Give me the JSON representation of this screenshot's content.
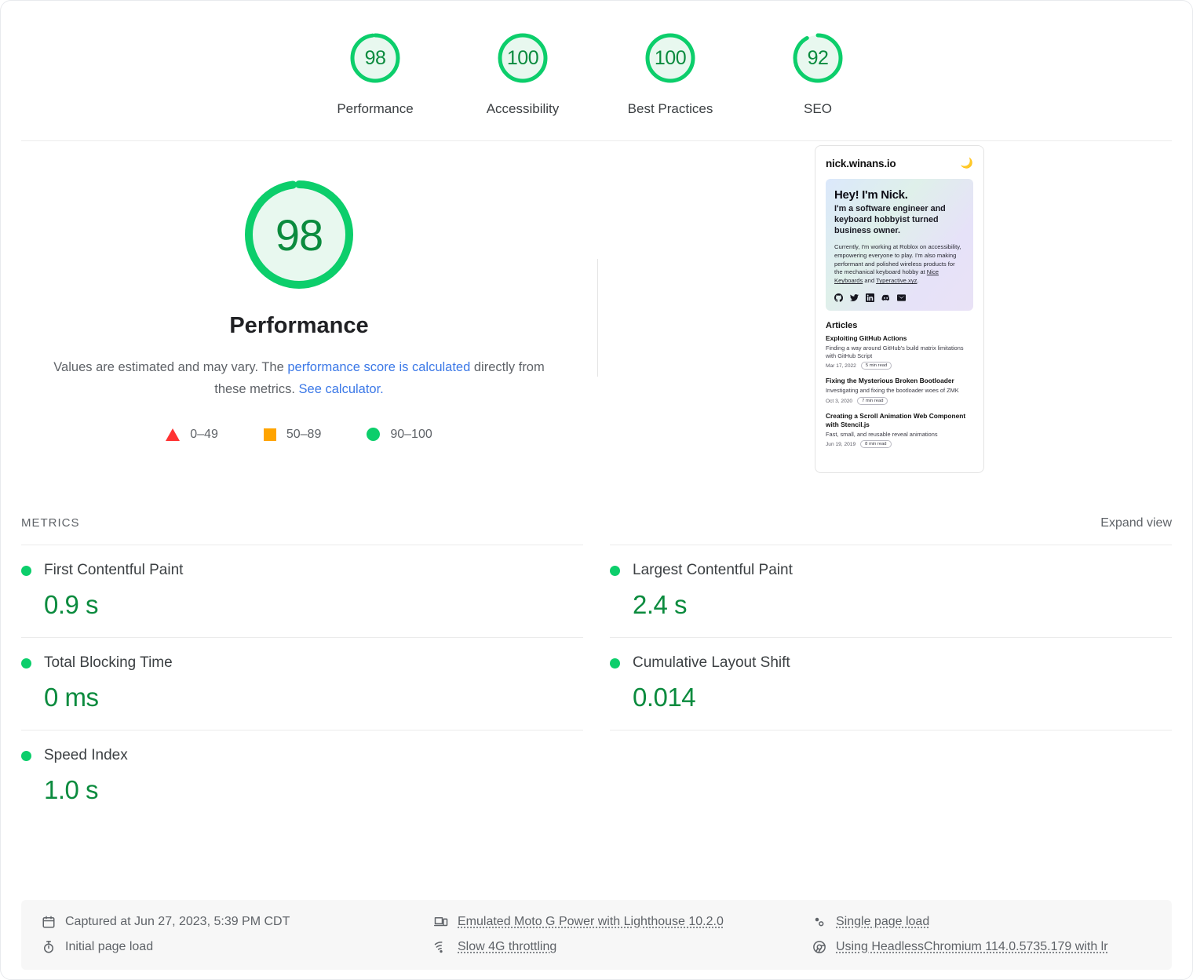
{
  "scores": [
    {
      "value": "98",
      "label": "Performance",
      "pct": 98
    },
    {
      "value": "100",
      "label": "Accessibility",
      "pct": 100
    },
    {
      "value": "100",
      "label": "Best Practices",
      "pct": 100
    },
    {
      "value": "92",
      "label": "SEO",
      "pct": 92
    }
  ],
  "performance": {
    "value": "98",
    "pct": 98,
    "title": "Performance",
    "desc_part1": "Values are estimated and may vary. The ",
    "desc_link1": "performance score is calculated",
    "desc_part2": " directly from these metrics. ",
    "desc_link2": "See calculator.",
    "legend": [
      {
        "icon": "triangle-icon",
        "range": "0–49"
      },
      {
        "icon": "square-icon",
        "range": "50–89"
      },
      {
        "icon": "circle-icon",
        "range": "90–100"
      }
    ]
  },
  "thumbnail": {
    "brand": "nick.winans.io",
    "theme_toggle_icon": "moon-icon",
    "hero_heading": "Hey! I'm Nick.",
    "hero_sub": "I'm a software engineer and keyboard hobbyist turned business owner.",
    "hero_body_1": "Currently, I'm working at Roblox on accessibility, empowering everyone to play. I'm also making performant and polished wireless products for the mechanical keyboard hobby at ",
    "hero_link_1": "Nice Keyboards",
    "hero_body_2": " and ",
    "hero_link_2": "Typeractive.xyz",
    "hero_body_3": ".",
    "social_icons": [
      "github-icon",
      "twitter-icon",
      "linkedin-icon",
      "discord-icon",
      "email-icon"
    ],
    "articles_heading": "Articles",
    "articles": [
      {
        "title": "Exploiting GitHub Actions",
        "desc": "Finding a way around GitHub's build matrix limitations with GitHub Script",
        "date": "Mar 17, 2022",
        "read": "5 min read"
      },
      {
        "title": "Fixing the Mysterious Broken Bootloader",
        "desc": "Investigating and fixing the bootloader woes of ZMK",
        "date": "Oct 3, 2020",
        "read": "7 min read"
      },
      {
        "title": "Creating a Scroll Animation Web Component with Stencil.js",
        "desc": "Fast, small, and reusable reveal animations",
        "date": "Jun 19, 2019",
        "read": "8 min read"
      }
    ]
  },
  "metrics_section": {
    "heading": "METRICS",
    "expand_label": "Expand view",
    "items": [
      {
        "name": "First Contentful Paint",
        "value": "0.9 s",
        "status": "pass"
      },
      {
        "name": "Largest Contentful Paint",
        "value": "2.4 s",
        "status": "pass"
      },
      {
        "name": "Total Blocking Time",
        "value": "0 ms",
        "status": "pass"
      },
      {
        "name": "Cumulative Layout Shift",
        "value": "0.014",
        "status": "pass"
      },
      {
        "name": "Speed Index",
        "value": "1.0 s",
        "status": "pass"
      }
    ]
  },
  "footer": {
    "captured": "Captured at Jun 27, 2023, 5:39 PM CDT",
    "initial_load": "Initial page load",
    "emulation": "Emulated Moto G Power with Lighthouse 10.2.0",
    "throttling": "Slow 4G throttling",
    "page_load": "Single page load",
    "user_agent": "Using HeadlessChromium 114.0.5735.179 with lr"
  },
  "colors": {
    "pass_green": "#0cce6b",
    "pass_text": "#0b8b3e",
    "average_orange": "#ffa400",
    "fail_red": "#ff3333",
    "link_blue": "#3b78e7"
  }
}
